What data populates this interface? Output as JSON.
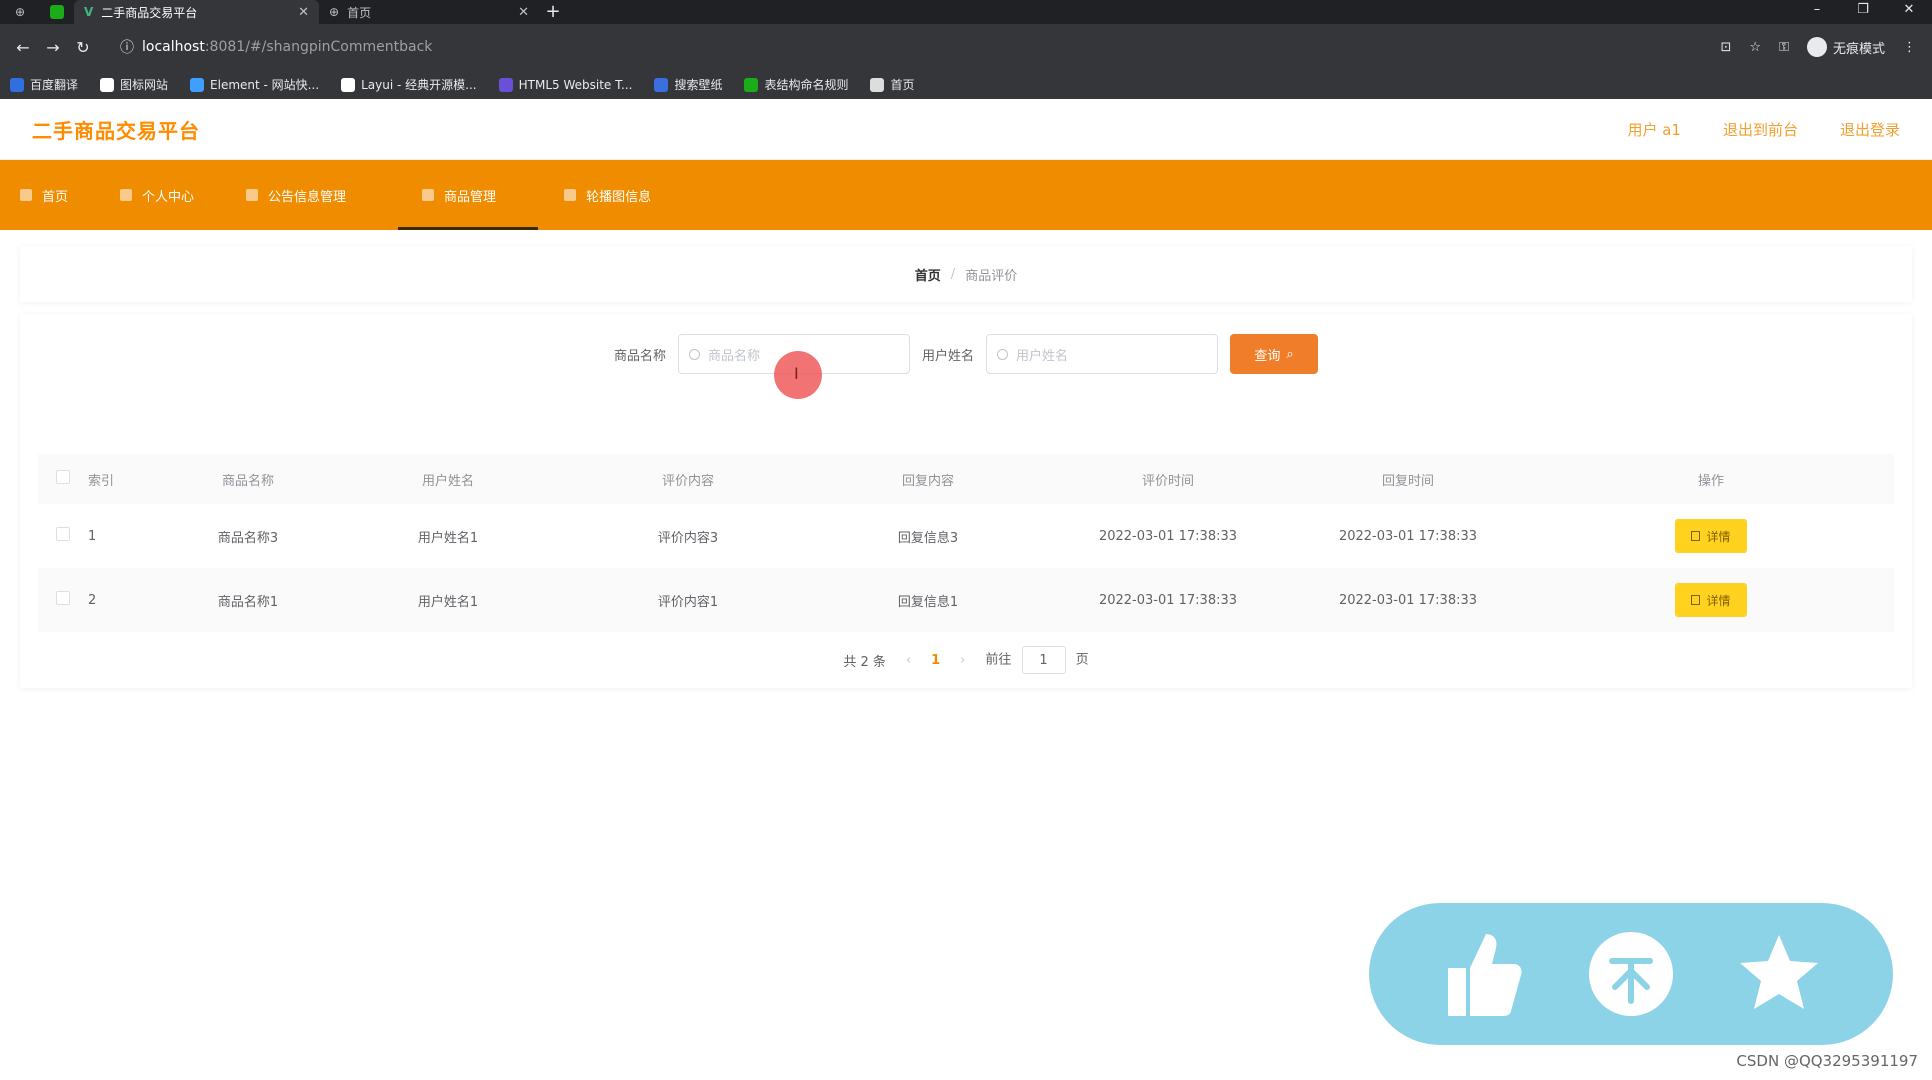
{
  "browser": {
    "tabs": [
      {
        "title": "二手商品交易平台"
      },
      {
        "title": "首页"
      }
    ],
    "url_host": "localhost",
    "url_path": ":8081/#/shangpinCommentback",
    "incognito_label": "无痕模式",
    "bookmarks": [
      {
        "label": "百度翻译",
        "color": "#2f6fe0"
      },
      {
        "label": "图标网站",
        "color": "#ffffff"
      },
      {
        "label": "Element - 网站快...",
        "color": "#409eff"
      },
      {
        "label": "Layui - 经典开源模...",
        "color": "#ffffff"
      },
      {
        "label": "HTML5 Website T...",
        "color": "#6b4fd8"
      },
      {
        "label": "搜索壁纸",
        "color": "#3b6ee0"
      },
      {
        "label": "表结构命名规则",
        "color": "#1aad19"
      },
      {
        "label": "首页",
        "color": "#dddddd"
      }
    ]
  },
  "app": {
    "title": "二手商品交易平台",
    "user_label": "用户 a1",
    "back_front": "退出到前台",
    "logout": "退出登录",
    "brand_color": "#f08c00"
  },
  "nav": {
    "items": [
      {
        "label": "首页"
      },
      {
        "label": "个人中心"
      },
      {
        "label": "公告信息管理"
      },
      {
        "label": "商品管理"
      },
      {
        "label": "轮播图信息"
      }
    ],
    "active_index": 3
  },
  "breadcrumb": {
    "home": "首页",
    "sep": "/",
    "current": "商品评价"
  },
  "search": {
    "name_label": "商品名称",
    "name_placeholder": "商品名称",
    "user_label": "用户姓名",
    "user_placeholder": "用户姓名",
    "query_button": "查询"
  },
  "table": {
    "headers": [
      "索引",
      "商品名称",
      "用户姓名",
      "评价内容",
      "回复内容",
      "评价时间",
      "回复时间",
      "操作"
    ],
    "rows": [
      {
        "index": "1",
        "product": "商品名称3",
        "user": "用户姓名1",
        "comment": "评价内容3",
        "reply": "回复信息3",
        "comment_time": "2022-03-01 17:38:33",
        "reply_time": "2022-03-01 17:38:33",
        "action": "详情"
      },
      {
        "index": "2",
        "product": "商品名称1",
        "user": "用户姓名1",
        "comment": "评价内容1",
        "reply": "回复信息1",
        "comment_time": "2022-03-01 17:38:33",
        "reply_time": "2022-03-01 17:38:33",
        "action": "详情"
      }
    ]
  },
  "pager": {
    "total": "共 2 条",
    "current": "1",
    "goto": "前往",
    "goto_value": "1",
    "page_unit": "页"
  },
  "watermark": "CSDN @QQ3295391197"
}
